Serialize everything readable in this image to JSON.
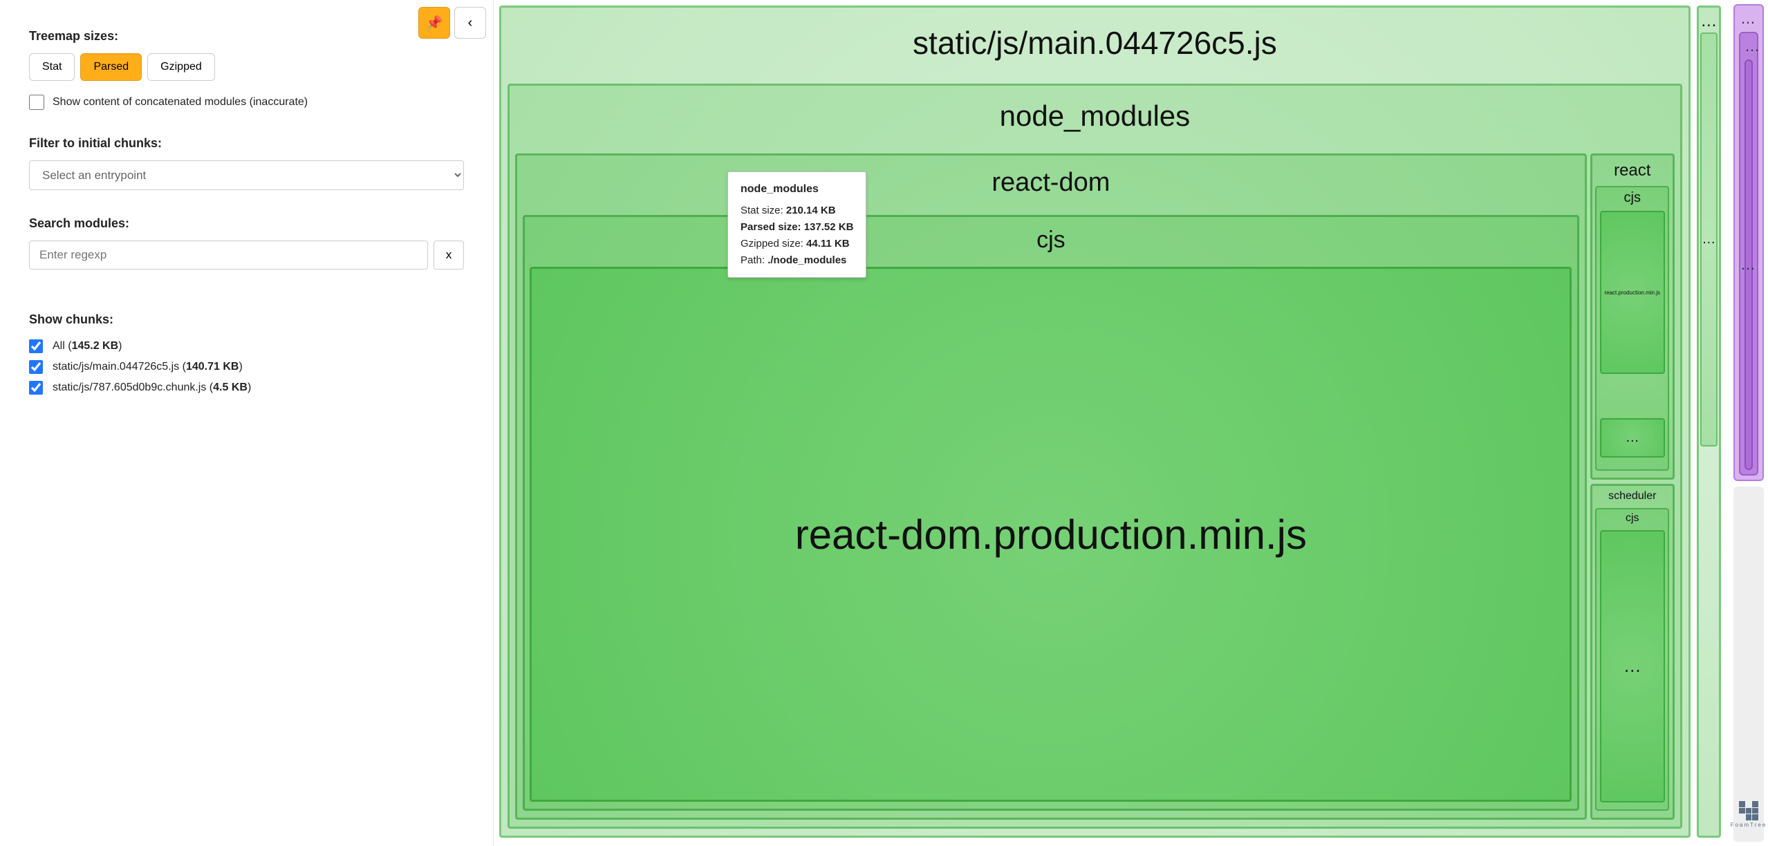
{
  "sidebar": {
    "treemap_sizes_label": "Treemap sizes:",
    "size_buttons": [
      "Stat",
      "Parsed",
      "Gzipped"
    ],
    "active_size_button": 1,
    "show_concat_label": "Show content of concatenated modules (inaccurate)",
    "filter_chunks_label": "Filter to initial chunks:",
    "entrypoint_placeholder": "Select an entrypoint",
    "search_modules_label": "Search modules:",
    "search_placeholder": "Enter regexp",
    "clear_btn": "x",
    "show_chunks_label": "Show chunks:",
    "chunks": [
      {
        "label": "All",
        "size": "145.2 KB",
        "checked": true
      },
      {
        "label": "static/js/main.044726c5.js",
        "size": "140.71 KB",
        "checked": true
      },
      {
        "label": "static/js/787.605d0b9c.chunk.js",
        "size": "4.5 KB",
        "checked": true
      }
    ],
    "pin_icon": "📌",
    "collapse_icon": "‹"
  },
  "tooltip": {
    "title": "node_modules",
    "stat_label": "Stat size: ",
    "stat_val": "210.14 KB",
    "parsed_label": "Parsed size: ",
    "parsed_val": "137.52 KB",
    "gzip_label": "Gzipped size: ",
    "gzip_val": "44.11 KB",
    "path_label": "Path: ",
    "path_val": "./node_modules"
  },
  "treemap": {
    "root_label": "static/js/main.044726c5.js",
    "node_modules_label": "node_modules",
    "react_dom_label": "react-dom",
    "cjs_label": "cjs",
    "react_dom_prod_label": "react-dom.production.min.js",
    "react_label": "react",
    "react_cjs_label": "cjs",
    "react_prod_label": "react.production.min.js",
    "scheduler_label": "scheduler",
    "scheduler_cjs_label": "cjs",
    "dots": "…",
    "rside_dots": "…"
  },
  "colors": {
    "level0": "#c1e8c0",
    "level0_border": "#7ac97a",
    "level1": "#a7dfa6",
    "level1_border": "#6bc06b",
    "level2": "#8fd68e",
    "level2_border": "#5ab55a",
    "level3": "#7bcf79",
    "level3_border": "#4daf4d",
    "level4": "#5fc75f",
    "level4_border": "#3ea93e"
  },
  "logo_label": "FoamTree"
}
